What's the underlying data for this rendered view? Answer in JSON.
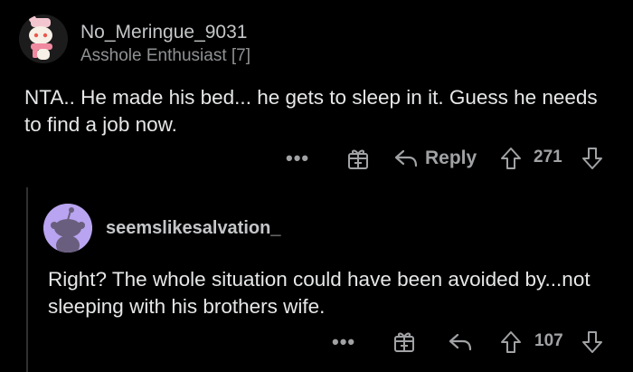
{
  "comment": {
    "username": "No_Meringue_9031",
    "flair": "Asshole Enthusiast [7]",
    "text": "NTA.. He made his bed... he gets to sleep in it.  Guess he needs to find a job now.",
    "actions": {
      "more": "•••",
      "reply_label": "Reply",
      "score": "271"
    }
  },
  "reply": {
    "username": "seemslikesalvation_",
    "text": "Right?  The whole situation could have been avoided by...not sleeping with his brothers wife.",
    "actions": {
      "more": "•••",
      "score": "107"
    }
  },
  "colors": {
    "background": "#000000",
    "text": "#e6e7e8",
    "muted": "#a0a2a4",
    "reply_avatar_bg": "#b8a4f0"
  }
}
